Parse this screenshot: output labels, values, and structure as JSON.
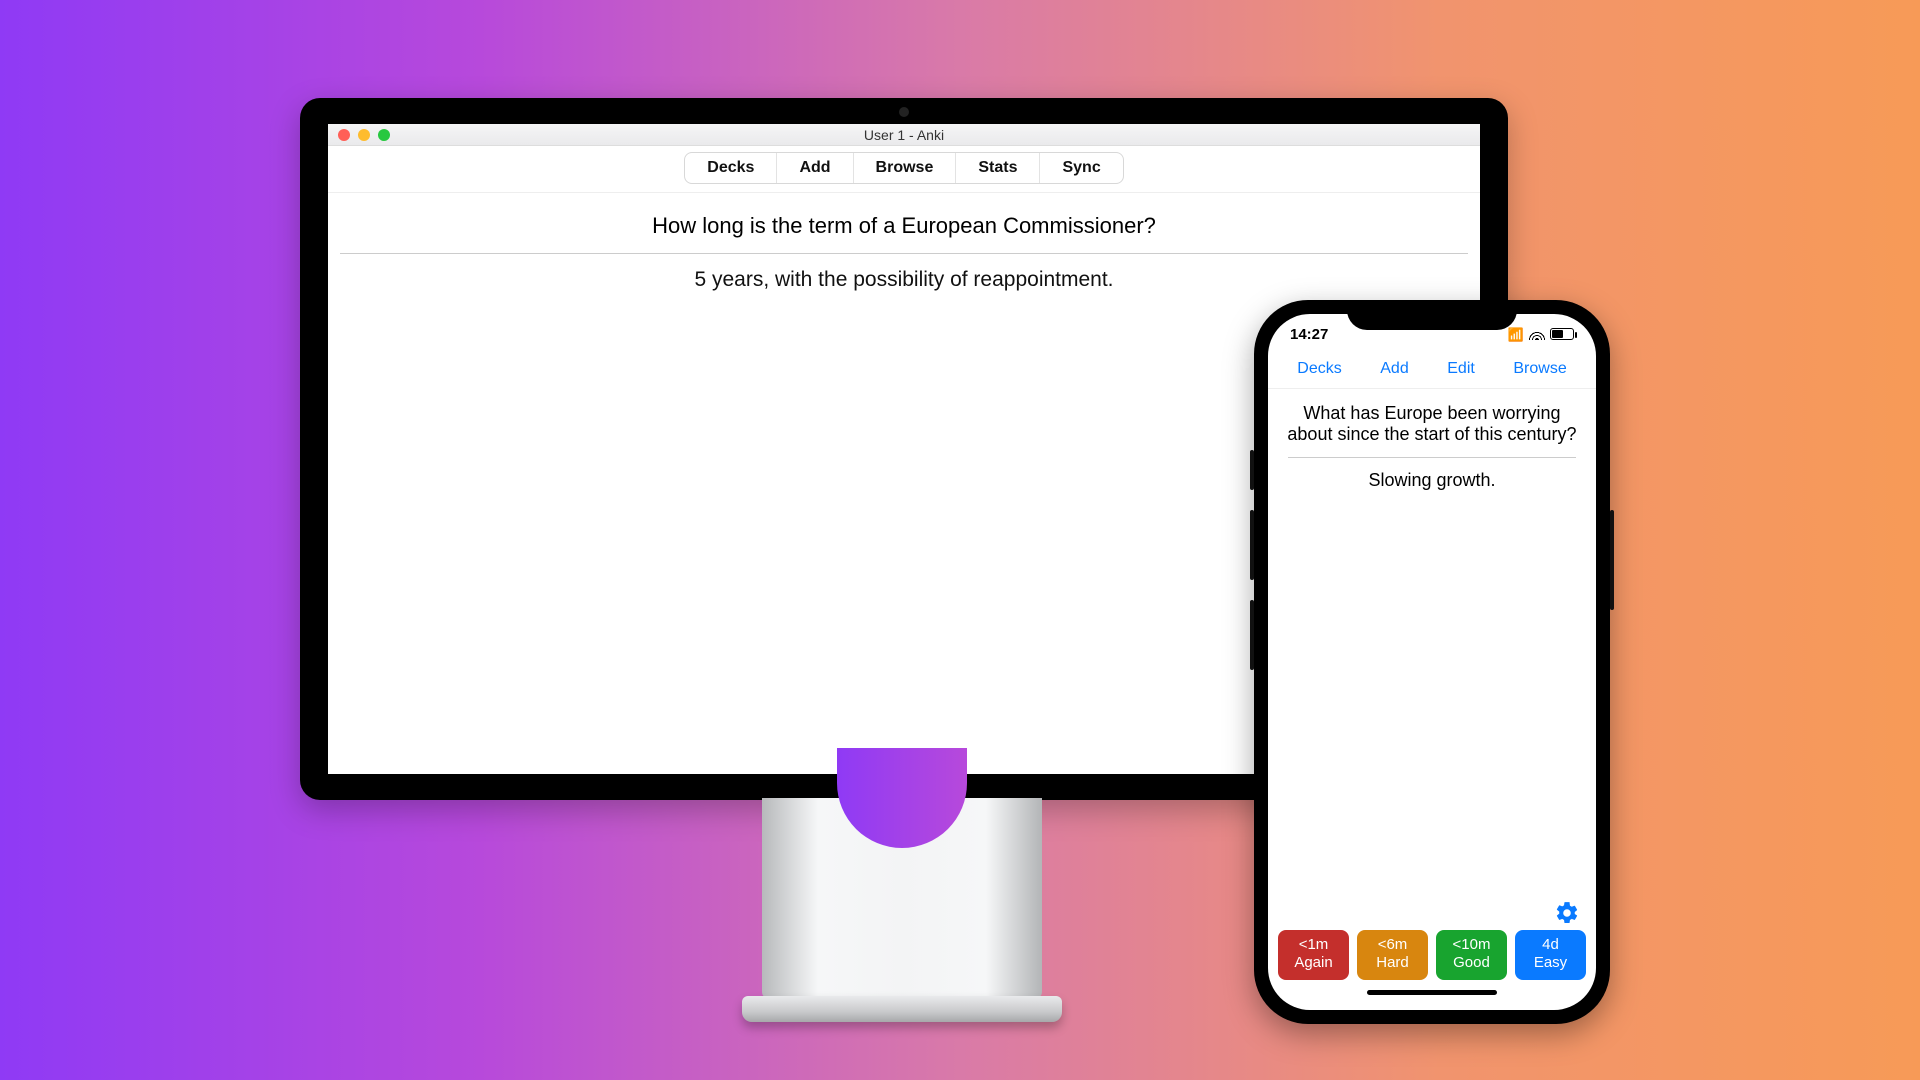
{
  "desktop": {
    "window_title": "User 1 - Anki",
    "tabs": [
      "Decks",
      "Add",
      "Browse",
      "Stats",
      "Sync"
    ],
    "question": "How long is the term of a European Commissioner?",
    "answer": "5 years, with the possibility of reappointment."
  },
  "phone": {
    "status": {
      "time": "14:27"
    },
    "nav": [
      "Decks",
      "Add",
      "Edit",
      "Browse"
    ],
    "question": "What has Europe been worrying about since the start of this century?",
    "answer": "Slowing growth.",
    "answer_buttons": [
      {
        "time": "<1m",
        "label": "Again",
        "color": "red"
      },
      {
        "time": "<6m",
        "label": "Hard",
        "color": "amber"
      },
      {
        "time": "<10m",
        "label": "Good",
        "color": "green"
      },
      {
        "time": "4d",
        "label": "Easy",
        "color": "blue"
      }
    ]
  }
}
